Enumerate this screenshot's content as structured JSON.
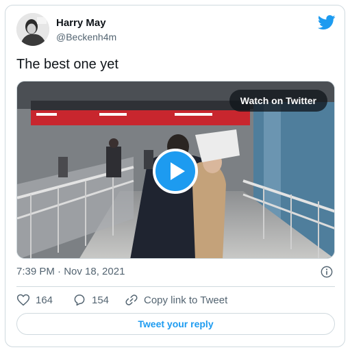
{
  "author": {
    "name": "Harry May",
    "handle": "@Beckenh4m"
  },
  "tweet": {
    "text": "The best one yet",
    "timestamp": "7:39 PM · Nov 18, 2021"
  },
  "media": {
    "watch_label": "Watch on Twitter"
  },
  "actions": {
    "likes": "164",
    "replies": "154",
    "copy_link_label": "Copy link to Tweet"
  },
  "reply_button_label": "Tweet your reply",
  "colors": {
    "accent": "#1d9bf0",
    "text_primary": "#0f1419",
    "text_secondary": "#536471",
    "border": "#cfd9de"
  },
  "icons": [
    "twitter-bird-icon",
    "play-icon",
    "info-icon",
    "heart-icon",
    "reply-bubble-icon",
    "link-icon"
  ]
}
